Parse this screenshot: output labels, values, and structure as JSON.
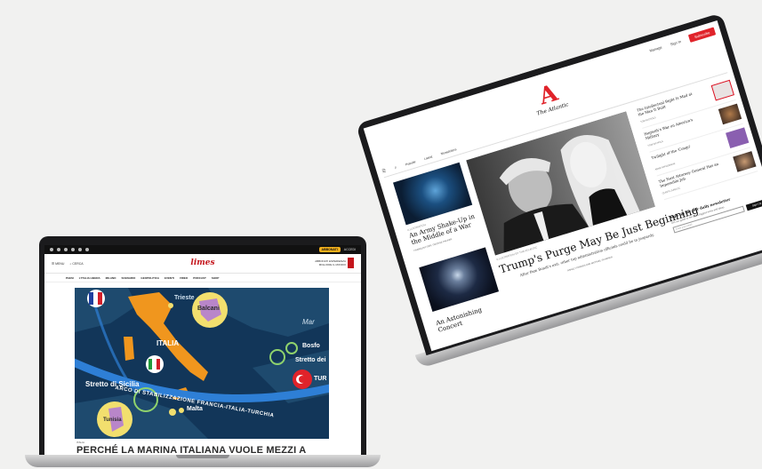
{
  "left_laptop": {
    "topbar": {
      "abbonati": "ABBONATI",
      "accedi": "ACCEDI"
    },
    "header": {
      "menu_label": "MENU",
      "search_label": "CERCA",
      "logo": "limes",
      "promo_text": "ABBONATI ESPERIENZA MIGLIORE IL MONDO"
    },
    "nav": [
      "PAESI",
      "L'ITALIA LIBERA",
      "MILANO",
      "SCENARIO",
      "GEOPOLITICA",
      "EVENTI",
      "VIDEO",
      "PODCAST",
      "SHOP"
    ],
    "map": {
      "labels": {
        "trieste": "Trieste",
        "balcani": "Balcani",
        "italia": "ITALIA",
        "stretto_sicilia": "Stretto di Sicilia",
        "tunisia": "Tunisia",
        "malta": "Malta",
        "bosforo": "Bosfo",
        "stretto_dei": "Stretto dei",
        "turchia": "TUR",
        "mar": "Mar",
        "arco": "ARCO DI STABILIZZAZIONE FRANCIA-ITALIA-TURCHIA"
      }
    },
    "article": {
      "tag": "ITALIA",
      "headline": "PERCHÉ LA MARINA ITALIANA VUOLE MEZZI A"
    }
  },
  "right_laptop": {
    "topnav": {
      "manage": "Manage",
      "signin": "Sign In",
      "subscribe": "Subscribe"
    },
    "logo_letter": "A",
    "logo_name": "The Atlantic",
    "menu": [
      "Popular",
      "Latest",
      "Newsletters"
    ],
    "left_column": [
      {
        "caption": "ILLUSTRATION",
        "headline": "An Army Shake-Up in the Middle of a War",
        "byline": "FRANKLIN FOER, GEORGE PACKER"
      },
      {
        "headline": "An Astonishing Concert"
      }
    ],
    "main": {
      "caption": "ILLUSTRATION BY THE ATLANTIC",
      "headline": "Trump's Purge May Be Just Beginning",
      "dek": "After Pam Bondi's exit, other top administration officials could be in jeopardy.",
      "byline": "ASHLEY PARKER AND MICHAEL SCHERER"
    },
    "sidebar": [
      {
        "title": "The Intellectual Right Is Mad at the Man It Built",
        "author": "TOM NICHOLS"
      },
      {
        "title": "Hegseth's War on America's Military",
        "author": "TOM NICHOLS"
      },
      {
        "title": "Twilight of the 'Congo'",
        "author": "ANNE APPLEBAUM"
      },
      {
        "title": "The Next Attorney General Has an Impossible Job",
        "author": "QUINTA JURECIC"
      }
    ],
    "newsletter": {
      "title": "Sign up for our daily newsletter",
      "sub": "Get our guide to the day's biggest news and ideas.",
      "placeholder": "Enter your email",
      "button": "Sign Up"
    }
  }
}
